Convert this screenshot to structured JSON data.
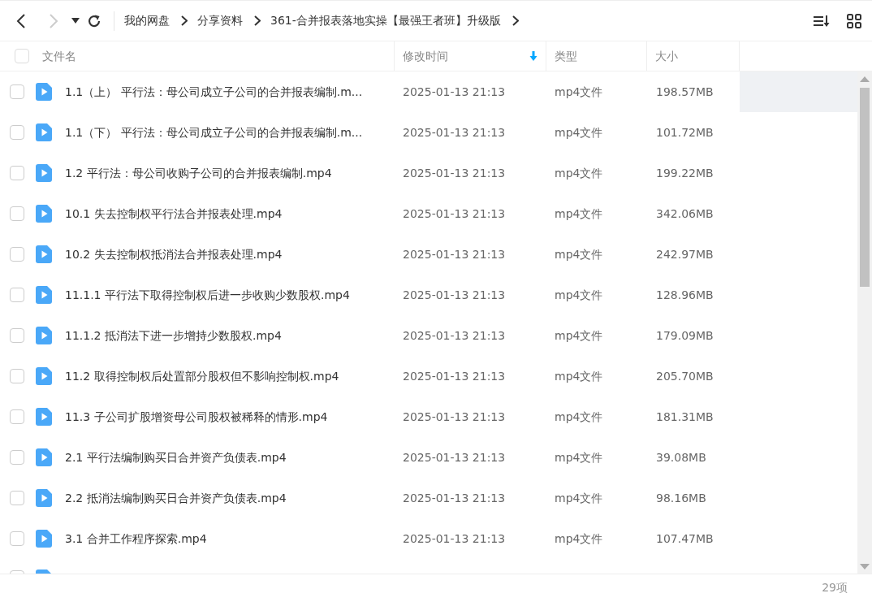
{
  "toolbar": {
    "back_enabled": true,
    "forward_enabled": false,
    "breadcrumb": [
      "我的网盘",
      "分享资料",
      "361-合并报表落地实操【最强王者班】升级版"
    ]
  },
  "table": {
    "all_checked": false,
    "columns": [
      {
        "label": "文件名",
        "sorted": false
      },
      {
        "label": "修改时间",
        "sorted": true
      },
      {
        "label": "类型",
        "sorted": false
      },
      {
        "label": "大小",
        "sorted": false
      }
    ],
    "rows": [
      {
        "name": "1.1（上） 平行法：母公司成立子公司的合并报表编制.m...",
        "modified": "2025-01-13 21:13",
        "type": "mp4文件",
        "size": "198.57MB",
        "checked": false,
        "hovered": true
      },
      {
        "name": "1.1（下） 平行法：母公司成立子公司的合并报表编制.m...",
        "modified": "2025-01-13 21:13",
        "type": "mp4文件",
        "size": "101.72MB",
        "checked": false,
        "hovered": false
      },
      {
        "name": "1.2 平行法：母公司收购子公司的合并报表编制.mp4",
        "modified": "2025-01-13 21:13",
        "type": "mp4文件",
        "size": "199.22MB",
        "checked": false,
        "hovered": false
      },
      {
        "name": "10.1 失去控制权平行法合并报表处理.mp4",
        "modified": "2025-01-13 21:13",
        "type": "mp4文件",
        "size": "342.06MB",
        "checked": false,
        "hovered": false
      },
      {
        "name": "10.2 失去控制权抵消法合并报表处理.mp4",
        "modified": "2025-01-13 21:13",
        "type": "mp4文件",
        "size": "242.97MB",
        "checked": false,
        "hovered": false
      },
      {
        "name": "11.1.1 平行法下取得控制权后进一步收购少数股权.mp4",
        "modified": "2025-01-13 21:13",
        "type": "mp4文件",
        "size": "128.96MB",
        "checked": false,
        "hovered": false
      },
      {
        "name": "11.1.2 抵消法下进一步增持少数股权.mp4",
        "modified": "2025-01-13 21:13",
        "type": "mp4文件",
        "size": "179.09MB",
        "checked": false,
        "hovered": false
      },
      {
        "name": "11.2 取得控制权后处置部分股权但不影响控制权.mp4",
        "modified": "2025-01-13 21:13",
        "type": "mp4文件",
        "size": "205.70MB",
        "checked": false,
        "hovered": false
      },
      {
        "name": "11.3 子公司扩股增资母公司股权被稀释的情形.mp4",
        "modified": "2025-01-13 21:13",
        "type": "mp4文件",
        "size": "181.31MB",
        "checked": false,
        "hovered": false
      },
      {
        "name": "2.1 平行法编制购买日合并资产负债表.mp4",
        "modified": "2025-01-13 21:13",
        "type": "mp4文件",
        "size": "39.08MB",
        "checked": false,
        "hovered": false
      },
      {
        "name": "2.2 抵消法编制购买日合并资产负债表.mp4",
        "modified": "2025-01-13 21:13",
        "type": "mp4文件",
        "size": "98.16MB",
        "checked": false,
        "hovered": false
      },
      {
        "name": "3.1 合并工作程序探索.mp4",
        "modified": "2025-01-13 21:13",
        "type": "mp4文件",
        "size": "107.47MB",
        "checked": false,
        "hovered": false
      },
      {
        "cut_off": true,
        "checked": false,
        "hovered": false
      }
    ]
  },
  "status_bar": {
    "count": "29项"
  }
}
